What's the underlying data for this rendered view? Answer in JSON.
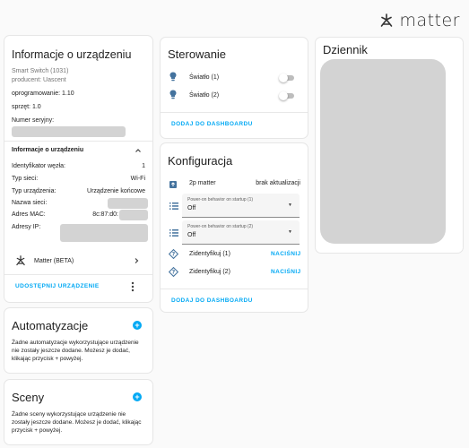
{
  "header": {
    "logo_text": "matter"
  },
  "device_info": {
    "title": "Informacje o urządzeniu",
    "model": "Smart Switch (1031)",
    "producer": "producent: Uascent",
    "firmware": "oprogramowanie: 1.10",
    "hardware": "sprzęt: 1.0",
    "serial_label": "Numer seryjny:",
    "section_title": "Informacje o urządzeniu",
    "rows": [
      {
        "label": "Identyfikator węzła:",
        "value": "1"
      },
      {
        "label": "Typ sieci:",
        "value": "Wi-Fi"
      },
      {
        "label": "Typ urządzenia:",
        "value": "Urządzenie końcowe"
      },
      {
        "label": "Nazwa sieci:",
        "value": ""
      },
      {
        "label": "Adres MAC:",
        "value": "8c:87:d0:"
      },
      {
        "label": "Adresy IP:",
        "value": ""
      }
    ],
    "integration_label": "Matter (BETA)",
    "share_button": "UDOSTĘPNIJ URZĄDZENIE"
  },
  "automations": {
    "title": "Automatyzacje",
    "text": "Żadne automatyzacje wykorzystujące urządzenie nie zostały jeszcze dodane. Możesz je dodać, klikając przycisk + powyżej."
  },
  "scenes": {
    "title": "Sceny",
    "text": "Żadne sceny wykorzystujące urządzenie nie zostały jeszcze dodane. Możesz je dodać, klikając przycisk + powyżej."
  },
  "controls": {
    "title": "Sterowanie",
    "items": [
      {
        "label": "Światło (1)",
        "state": "off"
      },
      {
        "label": "Światło (2)",
        "state": "off"
      }
    ],
    "add_button": "DODAJ DO DASHBOARDU"
  },
  "configuration": {
    "title": "Konfiguracja",
    "update_label": "2p matter",
    "update_status": "brak aktualizacji",
    "selects": [
      {
        "label": "Power-on behavior on startup (1)",
        "value": "Off"
      },
      {
        "label": "Power-on behavior on startup (2)",
        "value": "Off"
      }
    ],
    "identify": [
      {
        "label": "Zidentyfikuj (1)",
        "action": "NACIŚNIJ"
      },
      {
        "label": "Zidentyfikuj (2)",
        "action": "NACIŚNIJ"
      }
    ],
    "add_button": "DODAJ DO DASHBOARDU"
  },
  "logbook": {
    "title": "Dziennik"
  },
  "colors": {
    "accent": "#03a9f4",
    "bulb": "#44739e",
    "redacted": "#d3d3d3"
  },
  "icons": [
    "matter-logo-icon",
    "bulb-icon",
    "update-icon",
    "list-icon",
    "help-icon",
    "chevron-up-icon",
    "chevron-right-icon",
    "more-vert-icon",
    "plus-circle-icon"
  ]
}
